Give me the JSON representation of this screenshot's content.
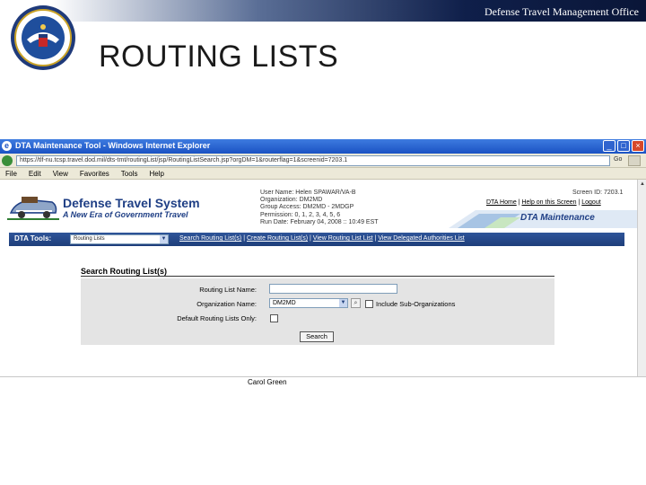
{
  "slide": {
    "org": "Defense Travel Management Office",
    "title": "ROUTING LISTS",
    "footer": "Carol Green"
  },
  "browser": {
    "window_title": "DTA Maintenance Tool - Windows Internet Explorer",
    "address": "https://tlf-nu.tcsp.travel.dod.mil/dts-tmt/routingList/jsp/RoutingListSearch.jsp?orgDM=1&routerflag=1&screenid=7203.1",
    "go": "Go",
    "menu": [
      "File",
      "Edit",
      "View",
      "Favorites",
      "Tools",
      "Help"
    ]
  },
  "dts": {
    "title": "Defense Travel System",
    "tagline": "A New Era of Government Travel",
    "user_lines": [
      "User Name: Helen SPAWAR/VA-B",
      "Organization: DM2MD",
      "Group Access: DM2MD - 2MDGP",
      "Permission: 0, 1, 2, 3, 4, 5, 6",
      "Run Date: February 04, 2008 :: 10:49 EST"
    ],
    "screen_id": "Screen ID: 7203.1",
    "links": [
      "DTA Home",
      "Help on this Screen",
      "Logout"
    ],
    "banner": "DTA Maintenance",
    "tools_label": "DTA Tools:",
    "tools_selected": "Routing Lists",
    "tools_links": [
      "Search Routing List(s)",
      "Create Routing List(s)",
      "View Routing List List",
      "View Delegated Authorities List"
    ]
  },
  "search": {
    "title": "Search Routing List(s)",
    "name_label": "Routing List Name:",
    "name_value": "",
    "org_label": "Organization Name:",
    "org_value": "DM2MD",
    "include_label": "Include Sub-Organizations",
    "default_label": "Default Routing Lists Only:",
    "button": "Search"
  },
  "colors": {
    "navy": "#1f3f85",
    "toolbar": "#2f5599",
    "panel": "#e4e4e4"
  }
}
